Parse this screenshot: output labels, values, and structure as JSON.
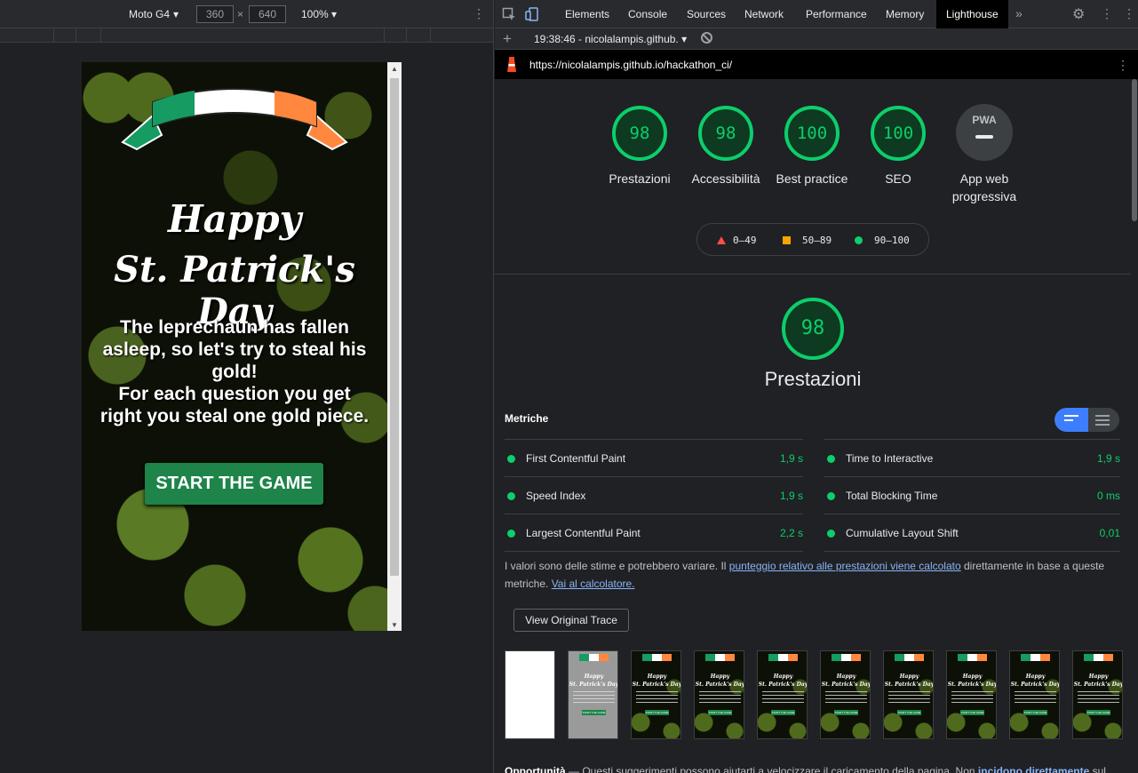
{
  "device_toolbar": {
    "device": "Moto G4",
    "width": "360",
    "height": "640",
    "times": "×",
    "zoom": "100%",
    "more": "⋮"
  },
  "page": {
    "title_line1": "Happy",
    "title_line2": "St. Patrick's Day",
    "intro_line1": "The leprechaun has fallen asleep, so let's try to steal his gold!",
    "intro_line2": "For each question you get right you steal one gold piece.",
    "start_button": "START THE GAME",
    "colors": {
      "green": "#169b62",
      "white": "#ffffff",
      "orange": "#ff883e",
      "button": "#1e8449"
    }
  },
  "devtools": {
    "tabs": [
      "Elements",
      "Console",
      "Sources",
      "Network",
      "Performance",
      "Memory",
      "Lighthouse"
    ],
    "active_tab": "Lighthouse",
    "more_tabs": "»",
    "report_select": "19:38:46 - nicolalampis.github.",
    "url": "https://nicolalampis.github.io/hackathon_ci/"
  },
  "lighthouse": {
    "scores": [
      {
        "label": "Prestazioni",
        "value": "98"
      },
      {
        "label": "Accessibilità",
        "value": "98"
      },
      {
        "label": "Best practice",
        "value": "100"
      },
      {
        "label": "SEO",
        "value": "100"
      }
    ],
    "pwa": {
      "badge": "PWA",
      "label_line1": "App web",
      "label_line2": "progressiva"
    },
    "legend": [
      "0–49",
      "50–89",
      "90–100"
    ],
    "performance_score": "98",
    "performance_title": "Prestazioni",
    "metrics_heading": "Metriche",
    "metrics": [
      {
        "name": "First Contentful Paint",
        "value": "1,9 s"
      },
      {
        "name": "Time to Interactive",
        "value": "1,9 s"
      },
      {
        "name": "Speed Index",
        "value": "1,9 s"
      },
      {
        "name": "Total Blocking Time",
        "value": "0 ms"
      },
      {
        "name": "Largest Contentful Paint",
        "value": "2,2 s"
      },
      {
        "name": "Cumulative Layout Shift",
        "value": "0,01"
      }
    ],
    "note_part1": "I valori sono delle stime e potrebbero variare. Il ",
    "note_link": "punteggio relativo alle prestazioni viene calcolato",
    "note_part2": " direttamente in base a queste metriche. ",
    "note_link2": "Vai al calcolatore.",
    "trace_button": "View Original Trace",
    "filmstrip_title_1": "Happy",
    "filmstrip_title_2": "St. Patrick's Day",
    "filmstrip_button": "START THE GAME",
    "opportunities_heading": "Opportunità",
    "opportunities_text": " — Questi suggerimenti possono aiutarti a velocizzare il caricamento della pagina. Non ",
    "opportunities_link": "incidono direttamente",
    "opportunities_tail": " sul"
  }
}
